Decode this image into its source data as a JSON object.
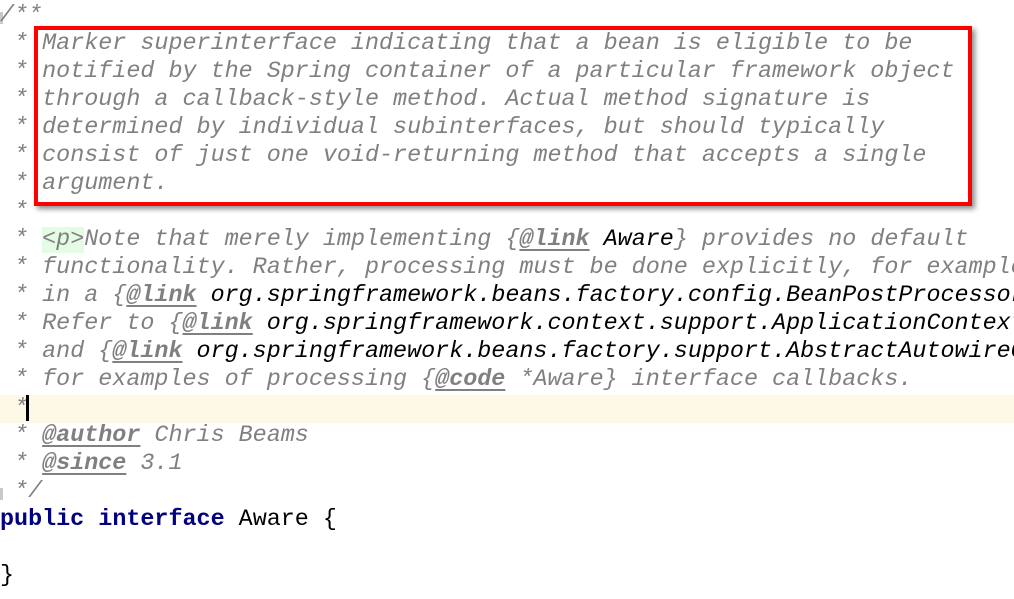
{
  "editor": {
    "language": "java",
    "lines": {
      "l0": "/**",
      "l1_star": " * ",
      "l1": "Marker superinterface indicating that a bean is eligible to be",
      "l2": "notified by the Spring container of a particular framework object",
      "l3": "through a callback-style method. Actual method signature is",
      "l4": "determined by individual subinterfaces, but should typically",
      "l5": "consist of just one void-returning method that accepts a single",
      "l6": "argument.",
      "l7": " *",
      "l8_tag": "<p>",
      "l8_text": "Note that merely implementing {",
      "l8_kw": "@link",
      "l8_ref": " Aware",
      "l8_rest": "} provides no default",
      "l9": "functionality. Rather, processing must be done explicitly, for example",
      "l10_pre": "in a {",
      "l10_kw": "@link",
      "l10_ref": " org.springframework.beans.factory.config.BeanPostProcessor",
      "l11_pre": "Refer to {",
      "l11_kw": "@link",
      "l11_ref": " org.springframework.context.support.ApplicationContextAwareProcessor",
      "l12_pre": "and {",
      "l12_kw": "@link",
      "l12_ref": " org.springframework.beans.factory.support.AbstractAutowireCapableBeanFactory",
      "l13_pre": "for examples of processing {",
      "l13_kw": "@code",
      "l13_rest": " *Aware} interface callbacks.",
      "l14": " *",
      "l15_kw": "@author",
      "l15_rest": " Chris Beams",
      "l16_kw": "@since",
      "l16_rest": " 3.1",
      "l17": " */",
      "l18_kw1": "public",
      "l18_kw2": "interface",
      "l18_rest": " Aware {",
      "l19": "",
      "l20": "}"
    }
  },
  "annotation": {
    "highlight_color": "#ff0000",
    "description": "highlighted class description"
  }
}
